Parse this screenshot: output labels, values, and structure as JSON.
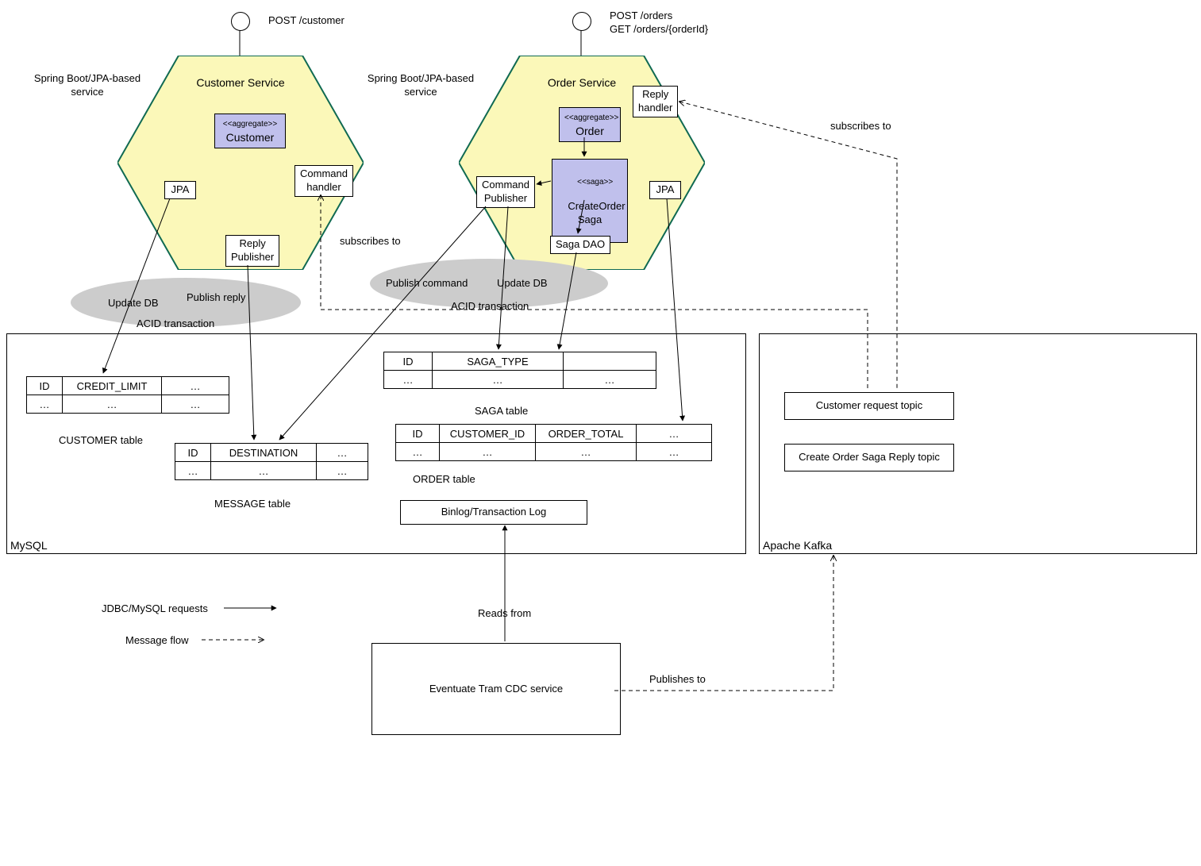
{
  "endpoints": {
    "customer": "POST /customer",
    "orders": "POST /orders\nGET /orders/{orderId}"
  },
  "serviceNote": "Spring Boot/JPA-based\nservice",
  "customerService": {
    "title": "Customer Service",
    "aggregateStereo": "<<aggregate>>",
    "aggregateName": "Customer",
    "jpa": "JPA",
    "commandHandler": "Command\nhandler",
    "replyPublisher": "Reply\nPublisher"
  },
  "orderService": {
    "title": "Order Service",
    "aggregateStereo": "<<aggregate>>",
    "aggregateName": "Order",
    "sagaStereo": "<<saga>>",
    "sagaName": "CreateOrder\nSaga",
    "jpa": "JPA",
    "replyHandler": "Reply\nhandler",
    "commandPublisher": "Command\nPublisher",
    "sagaDao": "Saga DAO"
  },
  "ellipses": {
    "left": {
      "updateDb": "Update DB",
      "publishReply": "Publish reply",
      "acid": "ACID transaction"
    },
    "right": {
      "publishCmd": "Publish command",
      "updateDb": "Update DB",
      "acid": "ACID transaction"
    }
  },
  "subscribesTo": "subscribes to",
  "tables": {
    "customer": {
      "name": "CUSTOMER table",
      "h": [
        "ID",
        "CREDIT_LIMIT",
        "…"
      ],
      "r": [
        "…",
        "…",
        "…"
      ]
    },
    "message": {
      "name": "MESSAGE table",
      "h": [
        "ID",
        "DESTINATION",
        "…"
      ],
      "r": [
        "…",
        "…",
        "…"
      ]
    },
    "saga": {
      "name": "SAGA table",
      "h": [
        "ID",
        "SAGA_TYPE",
        ""
      ],
      "r": [
        "…",
        "…",
        "…"
      ]
    },
    "order": {
      "name": "ORDER table",
      "h": [
        "ID",
        "CUSTOMER_ID",
        "ORDER_TOTAL",
        "…"
      ],
      "r": [
        "…",
        "…",
        "…",
        "…"
      ]
    }
  },
  "binlog": "Binlog/Transaction Log",
  "mysql": "MySQL",
  "kafka": {
    "label": "Apache Kafka",
    "topic1": "Customer request topic",
    "topic2": "Create Order Saga Reply topic"
  },
  "legend": {
    "jdbc": "JDBC/MySQL requests",
    "msg": "Message flow"
  },
  "cdc": "Eventuate Tram CDC service",
  "readsFrom": "Reads from",
  "publishesTo": "Publishes to"
}
